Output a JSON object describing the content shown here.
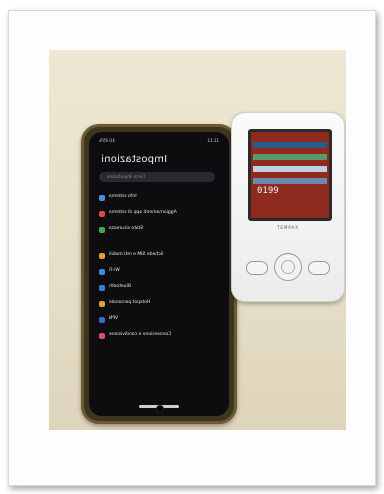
{
  "photo": {
    "phone": {
      "status_time": "11:12",
      "status_right": "4G 85%",
      "title": "Impostazioni",
      "search_placeholder": "Cerca impostazioni",
      "rows": [
        {
          "label": "Info sistema",
          "value": "",
          "color": "#4a90e2"
        },
        {
          "label": "Aggiornamenti app di sistema",
          "value": "",
          "color": "#e04a3a"
        },
        {
          "label": "Stato sicurezza",
          "value": "",
          "color": "#3aaa5a"
        },
        {
          "label": "Schede SIM e reti mobili",
          "value": "",
          "color": "#e0a020",
          "gap_before": true
        },
        {
          "label": "Wi-Fi",
          "value": "",
          "color": "#3a8ae0"
        },
        {
          "label": "Bluetooth",
          "value": "",
          "color": "#3a7ae0"
        },
        {
          "label": "Hotspot personale",
          "value": "",
          "color": "#e0a020"
        },
        {
          "label": "VPN",
          "value": "",
          "color": "#3a6ad0"
        },
        {
          "label": "Connessione e condivisione",
          "value": "",
          "color": "#e04a6a"
        }
      ]
    },
    "meter": {
      "reading": "0199",
      "brand": "TEMPAX"
    }
  }
}
